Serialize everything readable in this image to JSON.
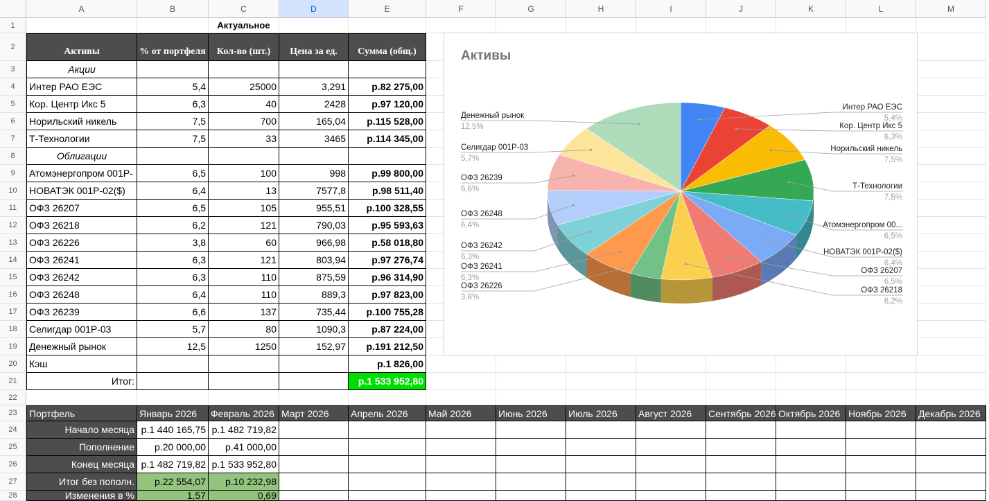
{
  "columns": [
    "A",
    "B",
    "C",
    "D",
    "E",
    "F",
    "G",
    "H",
    "I",
    "J",
    "K",
    "L",
    "M"
  ],
  "rows": [
    "1",
    "2",
    "3",
    "4",
    "5",
    "6",
    "7",
    "8",
    "9",
    "10",
    "11",
    "12",
    "13",
    "14",
    "15",
    "16",
    "17",
    "18",
    "19",
    "20",
    "21",
    "22",
    "23",
    "24",
    "25",
    "26",
    "27",
    "28"
  ],
  "title_row": {
    "label": "Актуальное"
  },
  "header": [
    "Активы",
    "% от портфеля",
    "Кол-во (шт.)",
    "Цена за ед.",
    "Сумма (общ.)"
  ],
  "sections": {
    "stocks": "Акции",
    "bonds": "Облигации"
  },
  "assets": [
    {
      "name": "Интер РАО ЕЭС",
      "pct": "5,4",
      "qty": "25000",
      "price": "3,291",
      "sum": "р.82 275,00"
    },
    {
      "name": "Кор. Центр Икс 5",
      "pct": "6,3",
      "qty": "40",
      "price": "2428",
      "sum": "р.97 120,00"
    },
    {
      "name": "Норильский никель",
      "pct": "7,5",
      "qty": "700",
      "price": "165,04",
      "sum": "р.115 528,00"
    },
    {
      "name": "Т-Технологии",
      "pct": "7,5",
      "qty": "33",
      "price": "3465",
      "sum": "р.114 345,00"
    },
    {
      "name": "Атомэнергопром 001Р-",
      "pct": "6,5",
      "qty": "100",
      "price": "998",
      "sum": "р.99 800,00"
    },
    {
      "name": "НОВАТЭК 001Р-02($)",
      "pct": "6,4",
      "qty": "13",
      "price": "7577,8",
      "sum": "р.98 511,40"
    },
    {
      "name": "ОФЗ 26207",
      "pct": "6,5",
      "qty": "105",
      "price": "955,51",
      "sum": "р.100 328,55"
    },
    {
      "name": "ОФЗ 26218",
      "pct": "6,2",
      "qty": "121",
      "price": "790,03",
      "sum": "р.95 593,63"
    },
    {
      "name": "ОФЗ 26226",
      "pct": "3,8",
      "qty": "60",
      "price": "966,98",
      "sum": "р.58 018,80"
    },
    {
      "name": "ОФЗ 26241",
      "pct": "6,3",
      "qty": "121",
      "price": "803,94",
      "sum": "р.97 276,74"
    },
    {
      "name": "ОФЗ 26242",
      "pct": "6,3",
      "qty": "110",
      "price": "875,59",
      "sum": "р.96 314,90"
    },
    {
      "name": "ОФЗ 26248",
      "pct": "6,4",
      "qty": "110",
      "price": "889,3",
      "sum": "р.97 823,00"
    },
    {
      "name": "ОФЗ 26239",
      "pct": "6,6",
      "qty": "137",
      "price": "735,44",
      "sum": "р.100 755,28"
    },
    {
      "name": "Селигдар 001Р-03",
      "pct": "5,7",
      "qty": "80",
      "price": "1090,3",
      "sum": "р.87 224,00"
    },
    {
      "name": "Денежный рынок",
      "pct": "12,5",
      "qty": "1250",
      "price": "152,97",
      "sum": "р.191 212,50"
    }
  ],
  "cash": {
    "label": "Кэш",
    "sum": "р.1 826,00"
  },
  "total": {
    "label": "Итог:",
    "sum": "р.1 533 952,80"
  },
  "portfolio": {
    "header": "Портфель",
    "months": [
      "Январь 2026",
      "Февраль 2026",
      "Март 2026",
      "Апрель 2026",
      "Май 2026",
      "Июнь 2026",
      "Июль 2026",
      "Август 2026",
      "Сентябрь 2026",
      "Октябрь 2026",
      "Ноябрь 2026",
      "Декабрь 2026"
    ],
    "rows": [
      {
        "label": "Начало месяца",
        "v1": "р.1 440 165,75",
        "v2": "р.1 482 719,82"
      },
      {
        "label": "Пополнение",
        "v1": "р.20 000,00",
        "v2": "р.41 000,00"
      },
      {
        "label": "Конец месяца",
        "v1": "р.1 482 719,82",
        "v2": "р.1 533 952,80"
      },
      {
        "label": "Итог без пополн.",
        "v1": "р.22 554,07",
        "v2": "р.10 232,98"
      },
      {
        "label": "Изменения в %",
        "v1": "1,57",
        "v2": "0,69"
      }
    ]
  },
  "chart_data": {
    "type": "pie",
    "title": "Активы",
    "slices": [
      {
        "label": "Интер РАО ЕЭС",
        "pct": "5,4%",
        "value": 5.4,
        "color": "#4285f4"
      },
      {
        "label": "Кор. Центр Икс 5",
        "pct": "6,3%",
        "value": 6.3,
        "color": "#ea4335"
      },
      {
        "label": "Норильский никель",
        "pct": "7,5%",
        "value": 7.5,
        "color": "#fbbc04"
      },
      {
        "label": "Т-Технологии",
        "pct": "7,5%",
        "value": 7.5,
        "color": "#34a853"
      },
      {
        "label": "Атомэнергопром 00...",
        "pct": "6,5%",
        "value": 6.5,
        "color": "#46bdc6"
      },
      {
        "label": "НОВАТЭК 001Р-02($)",
        "pct": "6,4%",
        "value": 6.4,
        "color": "#7baaf7"
      },
      {
        "label": "ОФЗ 26207",
        "pct": "6,5%",
        "value": 6.5,
        "color": "#f07b72"
      },
      {
        "label": "ОФЗ 26218",
        "pct": "6,2%",
        "value": 6.2,
        "color": "#fcd04f"
      },
      {
        "label": "ОФЗ 26226",
        "pct": "3,8%",
        "value": 3.8,
        "color": "#71c287"
      },
      {
        "label": "ОФЗ 26241",
        "pct": "6,3%",
        "value": 6.3,
        "color": "#ff994d"
      },
      {
        "label": "ОФЗ 26242",
        "pct": "6,3%",
        "value": 6.3,
        "color": "#7ed1d7"
      },
      {
        "label": "ОФЗ 26248",
        "pct": "6,4%",
        "value": 6.4,
        "color": "#b3cefb"
      },
      {
        "label": "ОФЗ 26239",
        "pct": "6,6%",
        "value": 6.6,
        "color": "#f7b4ae"
      },
      {
        "label": "Селигдар 001Р-03",
        "pct": "5,7%",
        "value": 5.7,
        "color": "#fde49b"
      },
      {
        "label": "Денежный рынок",
        "pct": "12,5%",
        "value": 12.5,
        "color": "#aedcba"
      }
    ]
  }
}
